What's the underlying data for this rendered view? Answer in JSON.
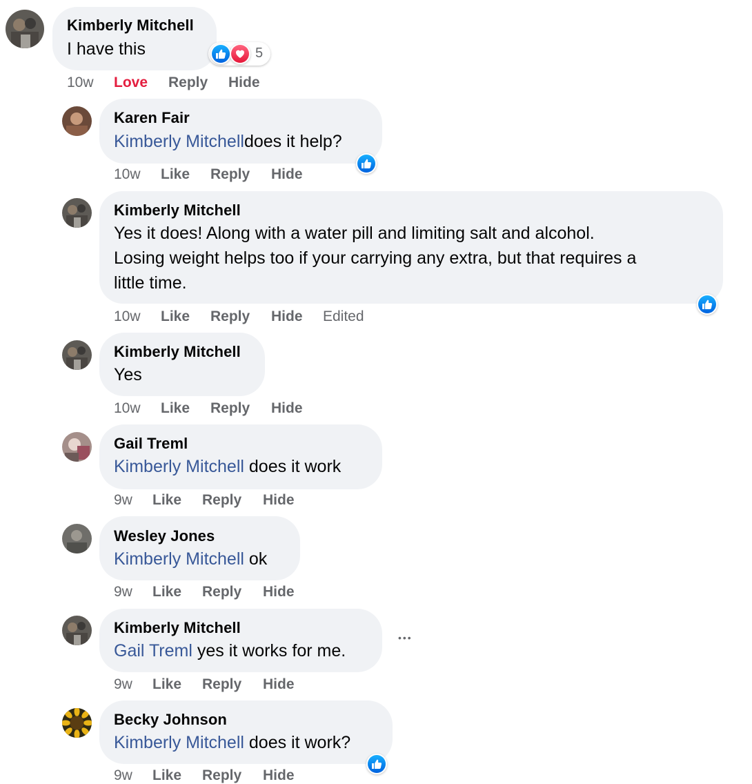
{
  "top_comment": {
    "author": "Kimberly Mitchell",
    "text": "I have this",
    "reaction_count": "5",
    "reactions": [
      "like-icon",
      "love-icon"
    ],
    "time": "10w",
    "actions": [
      "Love",
      "Reply",
      "Hide"
    ]
  },
  "replies": [
    {
      "author": "Karen Fair",
      "mention": "Kimberly Mitchell",
      "text": "does it help?",
      "time": "10w",
      "actions": [
        "Like",
        "Reply",
        "Hide"
      ],
      "reaction": "like-icon"
    },
    {
      "author": "Kimberly Mitchell",
      "lines": [
        "Yes it does! Along with a water pill and limiting salt and alcohol.",
        "Losing weight helps too if your carrying any extra, but that requires a",
        "little time."
      ],
      "time": "10w",
      "actions": [
        "Like",
        "Reply",
        "Hide"
      ],
      "edited": "Edited",
      "reaction": "like-icon"
    },
    {
      "author": "Kimberly Mitchell",
      "text": "Yes",
      "time": "10w",
      "actions": [
        "Like",
        "Reply",
        "Hide"
      ]
    },
    {
      "author": "Gail Treml",
      "mention": "Kimberly Mitchell",
      "text": " does it work",
      "time": "9w",
      "actions": [
        "Like",
        "Reply",
        "Hide"
      ]
    },
    {
      "author": "Wesley Jones",
      "mention": "Kimberly Mitchell",
      "text": " ok",
      "time": "9w",
      "actions": [
        "Like",
        "Reply",
        "Hide"
      ]
    },
    {
      "author": "Kimberly Mitchell",
      "mention": "Gail Treml",
      "text": " yes it works for me.",
      "time": "9w",
      "actions": [
        "Like",
        "Reply",
        "Hide"
      ],
      "more": "•••"
    },
    {
      "author": "Becky Johnson",
      "mention": "Kimberly Mitchell",
      "text": " does it work?",
      "time": "9w",
      "actions": [
        "Like",
        "Reply",
        "Hide"
      ],
      "reaction": "like-icon"
    }
  ],
  "colors": {
    "mention": "#385898",
    "love": "#e41e3f",
    "meta": "#65676b",
    "bubble": "#f0f2f5"
  }
}
